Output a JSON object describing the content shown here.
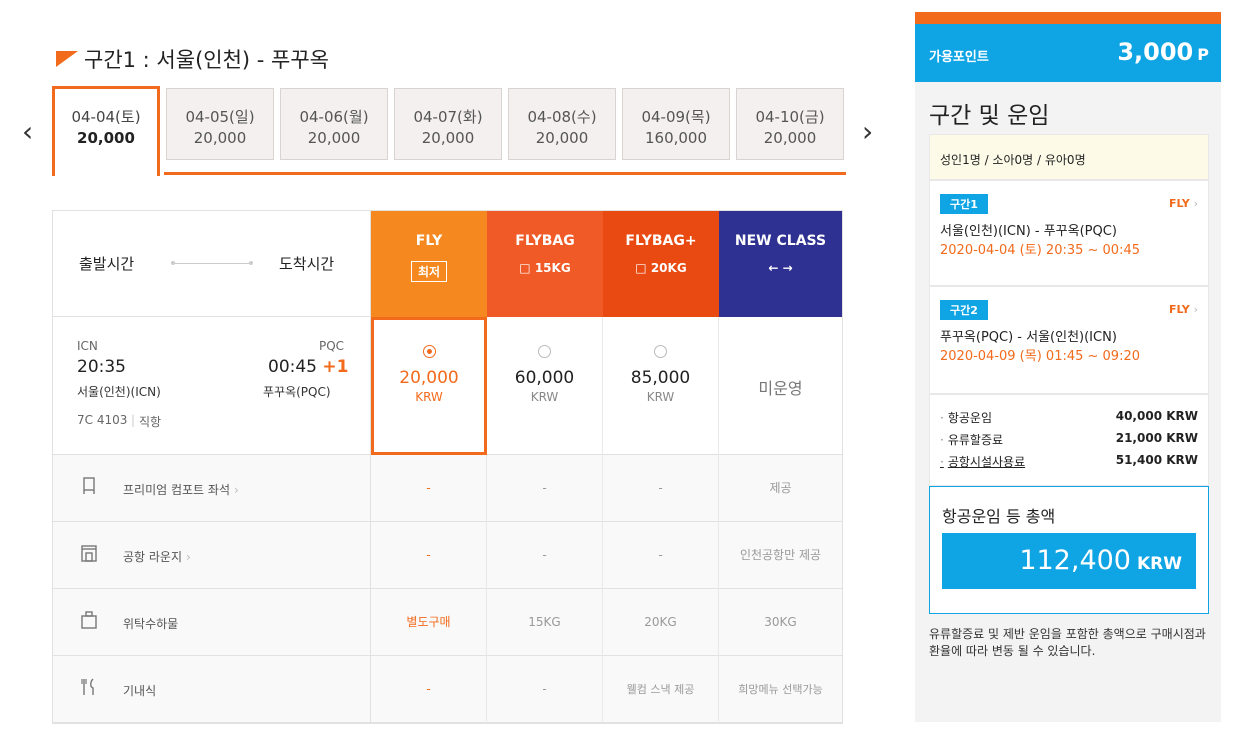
{
  "section": {
    "title": "구간1 : 서울(인천) - 푸꾸옥"
  },
  "date_tabs": [
    {
      "date": "04-04(토)",
      "price": "20,000"
    },
    {
      "date": "04-05(일)",
      "price": "20,000"
    },
    {
      "date": "04-06(월)",
      "price": "20,000"
    },
    {
      "date": "04-07(화)",
      "price": "20,000"
    },
    {
      "date": "04-08(수)",
      "price": "20,000"
    },
    {
      "date": "04-09(목)",
      "price": "160,000"
    },
    {
      "date": "04-10(금)",
      "price": "20,000"
    }
  ],
  "nav": {
    "prev": "‹",
    "next": "›"
  },
  "table": {
    "dep_label": "출발시간",
    "arr_label": "도착시간",
    "columns": [
      {
        "name": "FLY",
        "sub": "최저",
        "color": "#f5891f"
      },
      {
        "name": "FLYBAG",
        "sub": "15KG",
        "color": "#ef5a26"
      },
      {
        "name": "FLYBAG+",
        "sub": "20KG",
        "color": "#e84a12"
      },
      {
        "name": "NEW CLASS",
        "sub": "←  →",
        "color": "#2e3192"
      }
    ],
    "flight": {
      "from_code": "ICN",
      "to_code": "PQC",
      "dep_time": "20:35",
      "arr_time": "00:45",
      "arr_plus": "+1",
      "from_name": "서울(인천)(ICN)",
      "to_name": "푸꾸옥(PQC)",
      "flight_no": "7C 4103",
      "type": "직항"
    },
    "fares": [
      {
        "amount": "20,000",
        "currency": "KRW"
      },
      {
        "amount": "60,000",
        "currency": "KRW"
      },
      {
        "amount": "85,000",
        "currency": "KRW"
      },
      {
        "unavailable": "미운영"
      }
    ],
    "services": [
      {
        "label": "프리미엄 컴포트 좌석",
        "chev": "›",
        "values": [
          "-",
          "-",
          "-",
          "제공"
        ]
      },
      {
        "label": "공항 라운지",
        "chev": "›",
        "values": [
          "-",
          "-",
          "-",
          "인천공항만 제공"
        ]
      },
      {
        "label": "위탁수하물",
        "chev": "",
        "values": [
          "별도구매",
          "15KG",
          "20KG",
          "30KG"
        ]
      },
      {
        "label": "기내식",
        "chev": "",
        "values": [
          "-",
          "-",
          "웰컴 스낵 제공",
          "희망메뉴 선택가능"
        ]
      }
    ]
  },
  "sidebar": {
    "points_label": "가용포인트",
    "points_value": "3,000",
    "points_unit": "P",
    "title": "구간 및 운임",
    "pax": "성인1명 / 소아0명 / 유아0명",
    "segments": [
      {
        "tag": "구간1",
        "fare": "FLY",
        "chev": "›",
        "route": "서울(인천)(ICN) - 푸꾸옥(PQC)",
        "datetime": "2020-04-04 (토) 20:35 ~ 00:45"
      },
      {
        "tag": "구간2",
        "fare": "FLY",
        "chev": "›",
        "route": "푸꾸옥(PQC) - 서울(인천)(ICN)",
        "datetime": "2020-04-09 (목) 01:45 ~ 09:20"
      }
    ],
    "costs": [
      {
        "label": "항공운임",
        "value": "40,000 KRW"
      },
      {
        "label": "유류할증료",
        "value": "21,000 KRW"
      },
      {
        "label": "공항시설사용료",
        "value": "51,400 KRW"
      }
    ],
    "total_label": "항공운임 등 총액",
    "total_value": "112,400",
    "total_unit": "KRW",
    "note": "유류할증료 및 제반 운임을 포함한 총액으로 구매시점과 환율에 따라 변동 될 수 있습니다."
  },
  "colors": {
    "accent": "#f26a1b",
    "blue": "#0fa4e4"
  }
}
